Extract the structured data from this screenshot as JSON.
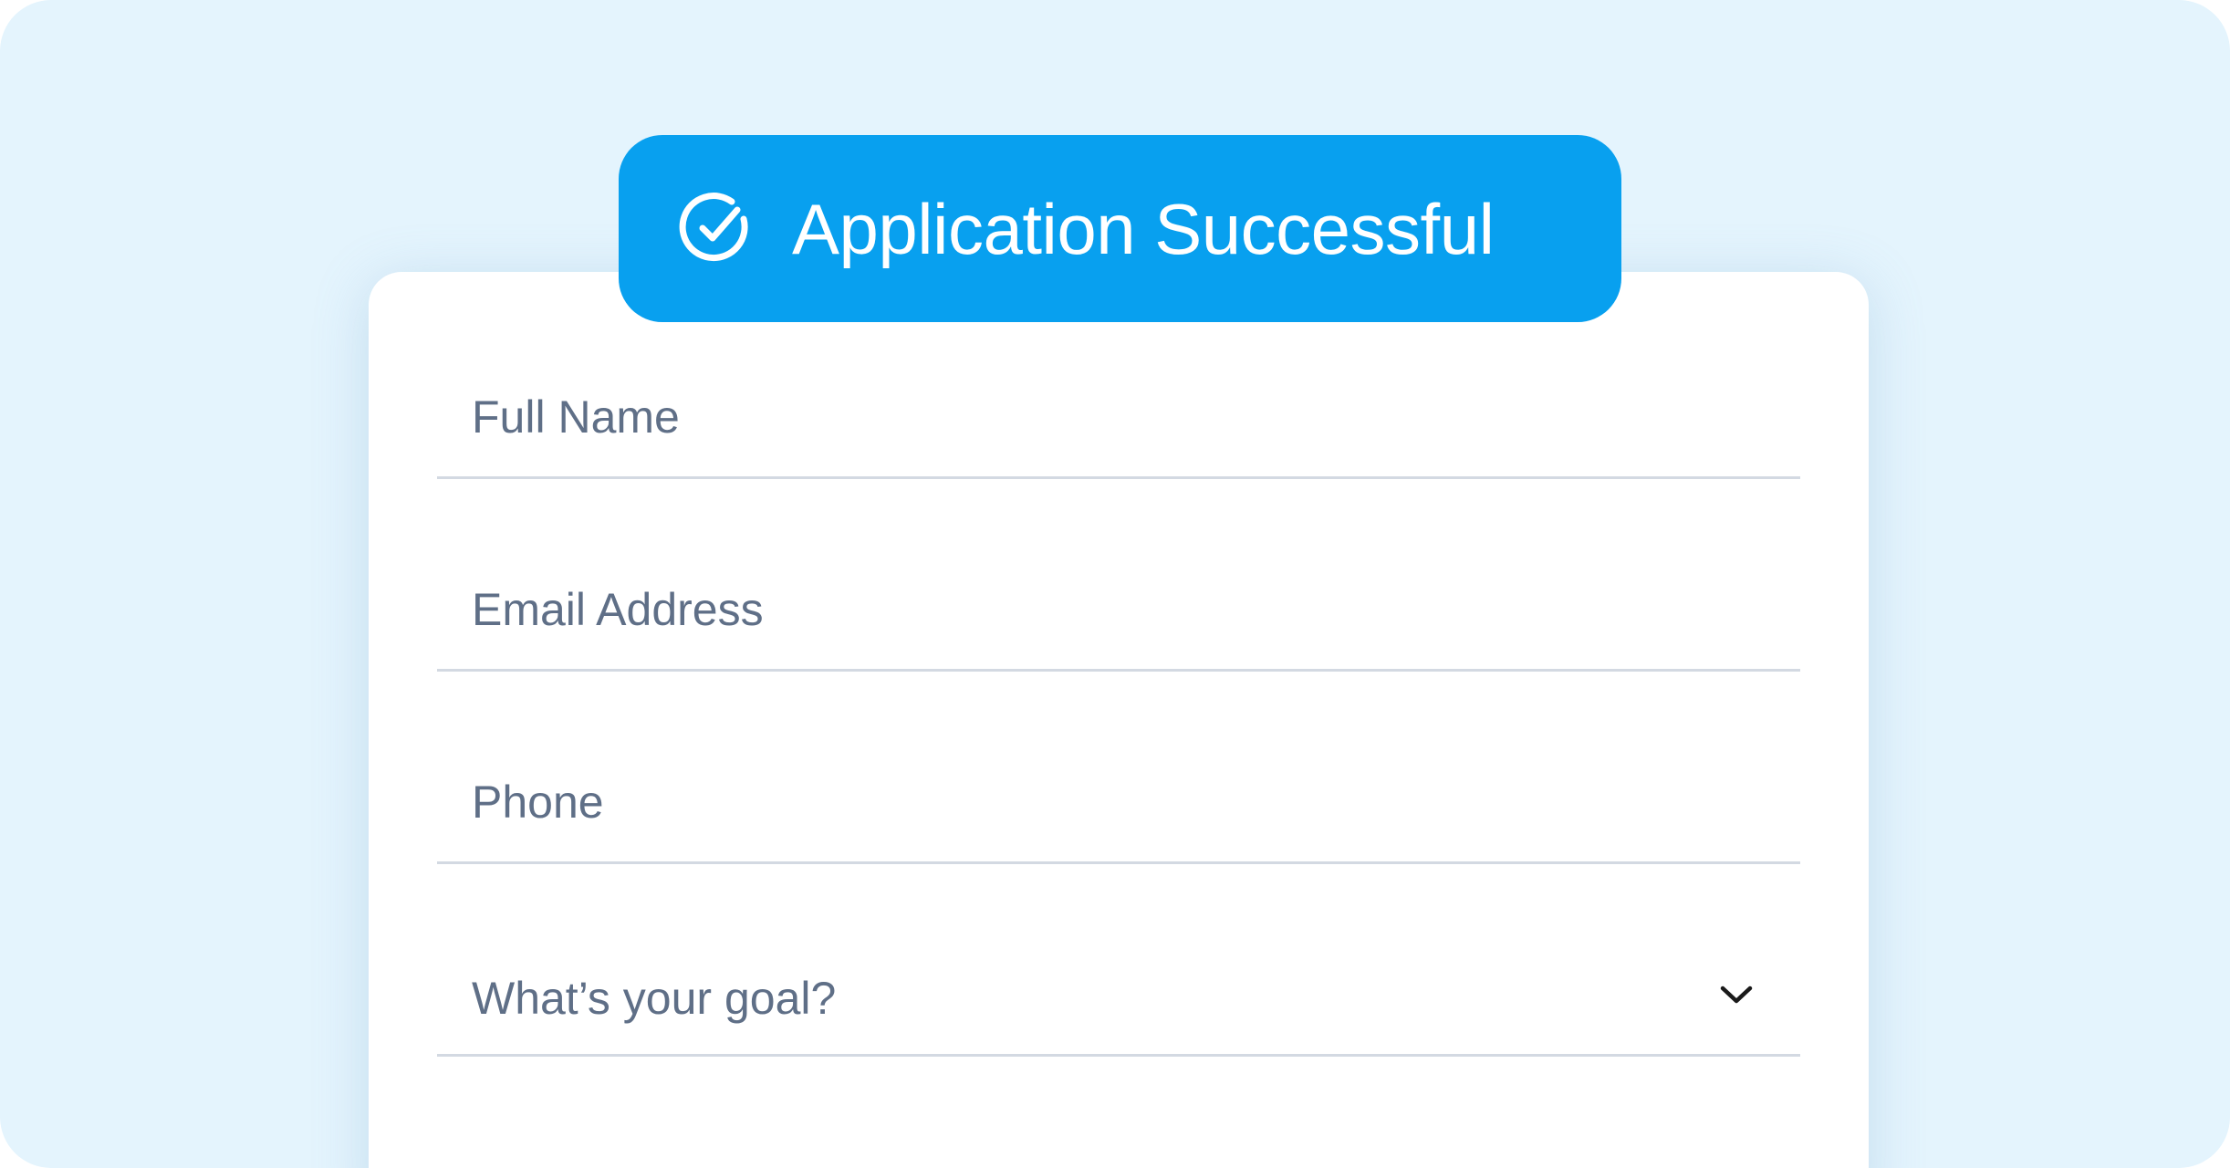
{
  "status_badge": {
    "label": "Application Successful",
    "icon": "check-circle-icon",
    "background_color": "#08a0ef",
    "text_color": "#ffffff"
  },
  "form": {
    "fields": [
      {
        "placeholder": "Full Name",
        "value": ""
      },
      {
        "placeholder": "Email Address",
        "value": ""
      },
      {
        "placeholder": "Phone",
        "value": ""
      }
    ],
    "goal_select": {
      "selected_label": "What’s your goal?",
      "icon": "chevron-down-icon"
    }
  },
  "colors": {
    "page_background": "#e4f4fd",
    "card_background": "#ffffff",
    "field_text": "#5f6f87",
    "field_divider": "#d3d9e2"
  }
}
